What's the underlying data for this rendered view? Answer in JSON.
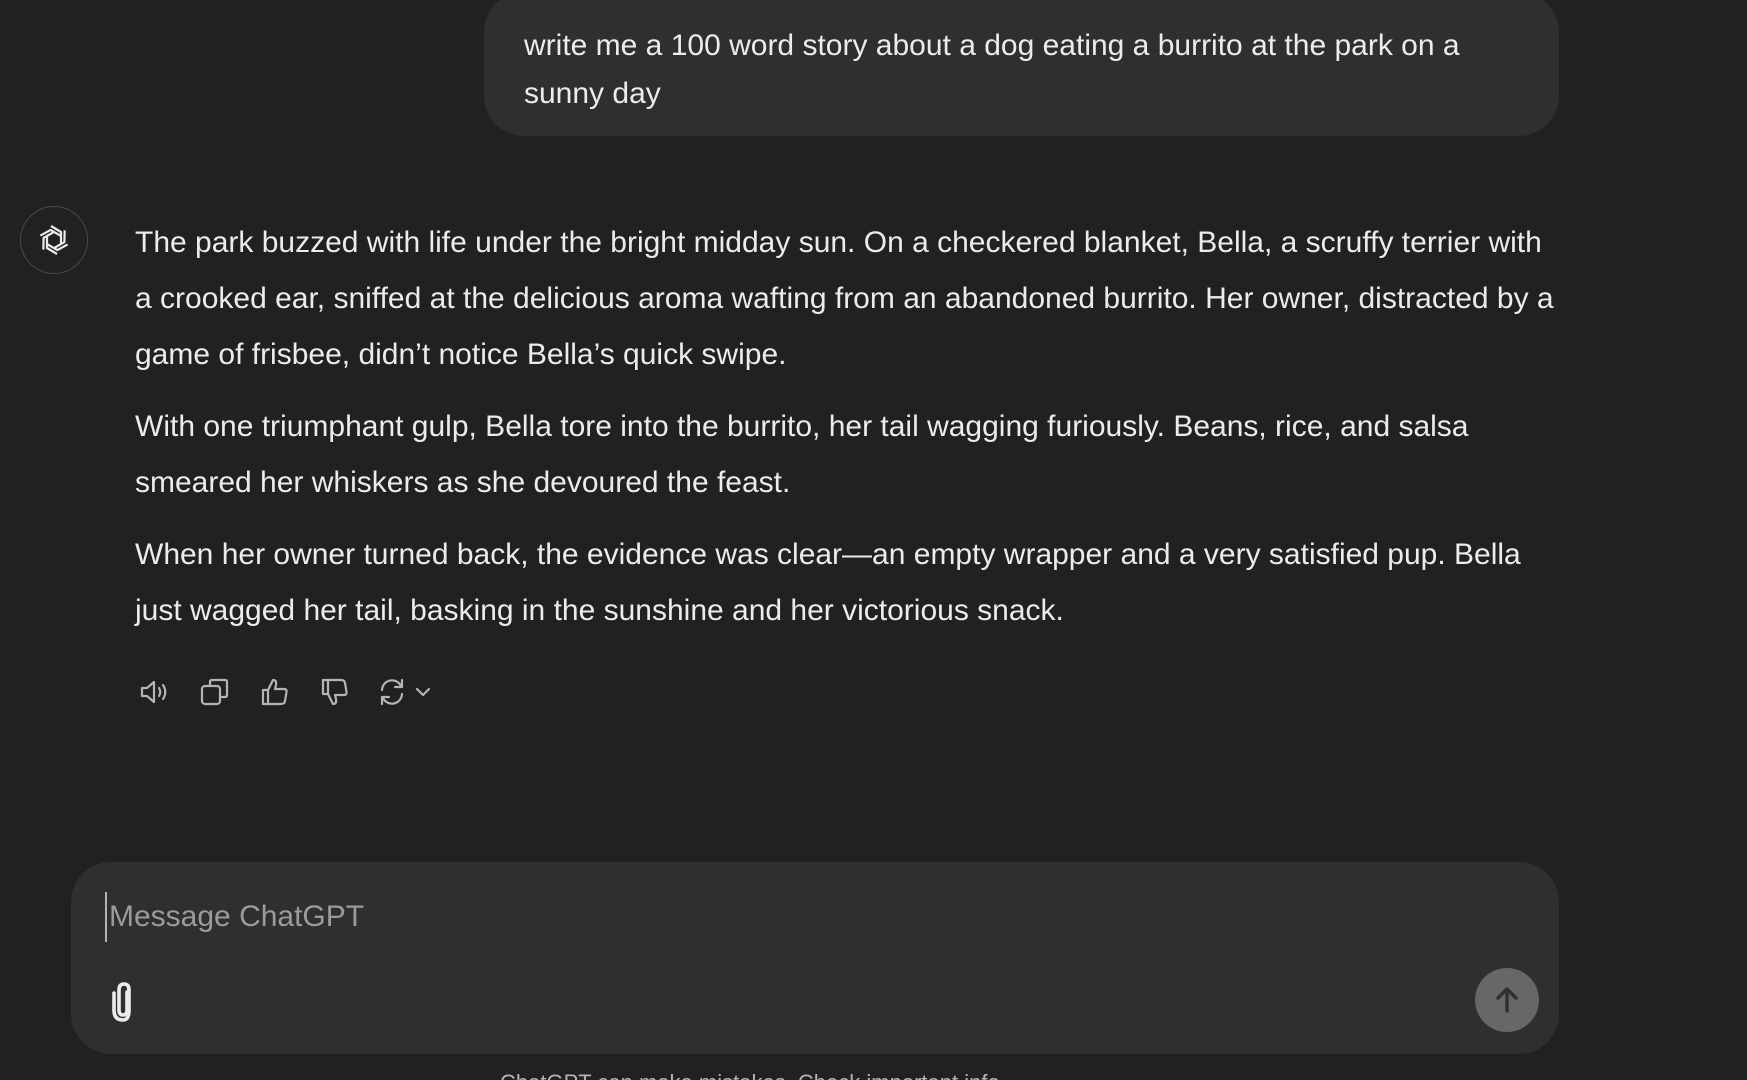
{
  "user_message": {
    "text": "write me a 100 word story about a dog eating a burrito at the park on a sunny day"
  },
  "assistant_message": {
    "avatar_icon": "openai-logo-icon",
    "paragraphs": [
      "The park buzzed with life under the bright midday sun. On a checkered blanket, Bella, a scruffy terrier with a crooked ear, sniffed at the delicious aroma wafting from an abandoned burrito. Her owner, distracted by a game of frisbee, didn’t notice Bella’s quick swipe.",
      "With one triumphant gulp, Bella tore into the burrito, her tail wagging furiously. Beans, rice, and salsa smeared her whiskers as she devoured the feast.",
      "When her owner turned back, the evidence was clear—an empty wrapper and a very satisfied pup. Bella just wagged her tail, basking in the sunshine and her victorious snack."
    ],
    "actions": [
      {
        "name": "read-aloud-icon"
      },
      {
        "name": "copy-icon"
      },
      {
        "name": "thumbs-up-icon"
      },
      {
        "name": "thumbs-down-icon"
      },
      {
        "name": "regenerate-icon"
      }
    ]
  },
  "composer": {
    "placeholder": "Message ChatGPT",
    "value": "",
    "attach_icon": "paperclip-icon",
    "send_icon": "arrow-up-icon"
  },
  "footer": {
    "disclaimer": "ChatGPT can make mistakes. Check important info."
  },
  "colors": {
    "background": "#212121",
    "bubble": "#2f2f2f",
    "text": "#ececec",
    "placeholder": "#9b9b9b",
    "send_button": "#676767"
  }
}
